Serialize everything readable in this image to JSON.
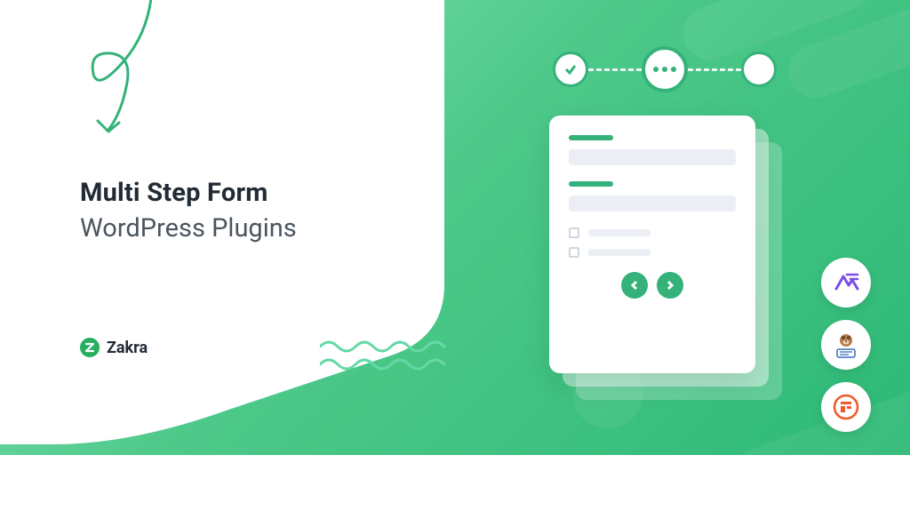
{
  "headline": {
    "line1": "Multi Step Form",
    "line2": "WordPress Plugins"
  },
  "brand": {
    "name": "Zakra",
    "color": "#27ae60"
  },
  "stepper": {
    "steps": [
      "done",
      "active",
      "pending"
    ]
  },
  "form_preview": {
    "sections": 2,
    "checkboxes": 2
  },
  "plugin_icons": [
    {
      "name": "everest-forms",
      "accent": "#7a4ee6"
    },
    {
      "name": "wpforms",
      "accent": "#e27a3f"
    },
    {
      "name": "formidable",
      "accent": "#f05a28"
    }
  ],
  "palette": {
    "green": "#34b27a",
    "text_dark": "#222b35",
    "text_muted": "#4b5560"
  }
}
